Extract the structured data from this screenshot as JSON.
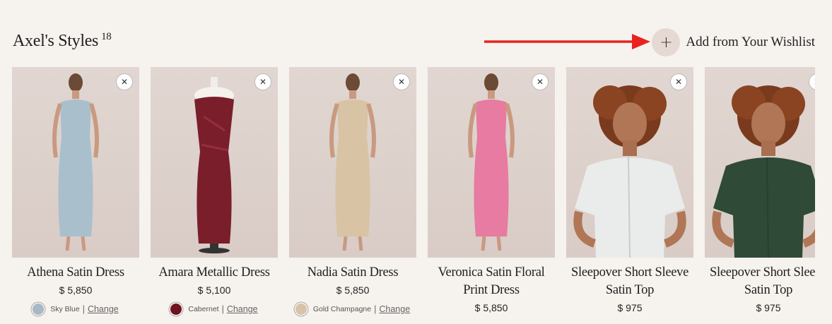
{
  "header": {
    "title": "Axel's Styles",
    "count": "18",
    "add_label": "Add from Your Wishlist",
    "add_icon": "plus-icon"
  },
  "colors": {
    "background": "#f6f2ee",
    "arrow": "#e8231f",
    "add_circle": "#e6d8d2"
  },
  "products": [
    {
      "name": "Athena Satin Dress",
      "price": "$ 5,850",
      "color_name": "Sky Blue",
      "swatch": "#a8b9c4",
      "change": "Change",
      "dress": "#a9c0cc",
      "kind": "dress"
    },
    {
      "name": "Amara Metallic Dress",
      "price": "$ 5,100",
      "color_name": "Cabernet",
      "swatch": "#6e1320",
      "change": "Change",
      "dress": "#7a1e2c",
      "kind": "mannequin"
    },
    {
      "name": "Nadia Satin Dress",
      "price": "$ 5,850",
      "color_name": "Gold Champagne",
      "swatch": "#d9c3a8",
      "change": "Change",
      "dress": "#d8c3a4",
      "kind": "dress"
    },
    {
      "name": "Veronica Satin Floral Print Dress",
      "price": "$ 5,850",
      "color_name": "",
      "swatch": "",
      "change": "",
      "dress": "#e77ba1",
      "kind": "dress"
    },
    {
      "name": "Sleepover Short Sleeve Satin Top",
      "price": "$ 975",
      "color_name": "",
      "swatch": "",
      "change": "",
      "dress": "#e9ecea",
      "kind": "top"
    },
    {
      "name": "Sleepover Short Sleeve Satin Top",
      "price": "$ 975",
      "color_name": "",
      "swatch": "",
      "change": "",
      "dress": "#2f4a37",
      "kind": "top"
    }
  ]
}
